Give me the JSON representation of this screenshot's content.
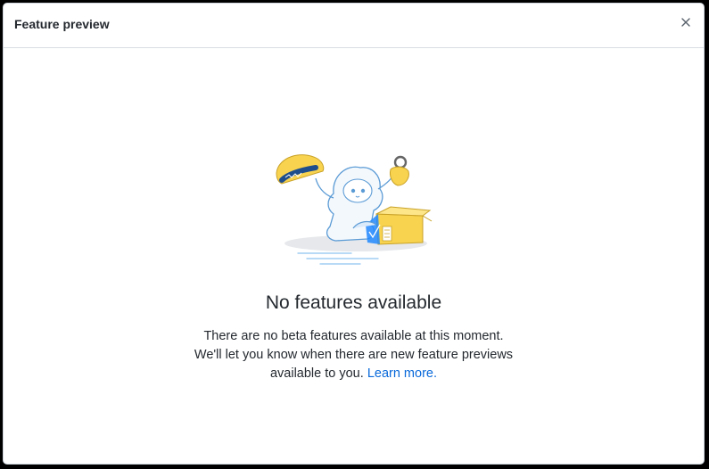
{
  "dialog": {
    "title": "Feature preview",
    "close_icon": "close-icon"
  },
  "empty_state": {
    "illustration_icon": "octocat-unboxing-illustration",
    "heading": "No features available",
    "line1": "There are no beta features available at this moment.",
    "line2": "We'll let you know when there are new feature previews",
    "line3": "available to you.",
    "link_label": "Learn more."
  },
  "colors": {
    "link": "#0969da",
    "text": "#24292f",
    "border": "#d0d7de",
    "accent_yellow": "#f8d34f",
    "accent_blue": "#2188ff"
  }
}
